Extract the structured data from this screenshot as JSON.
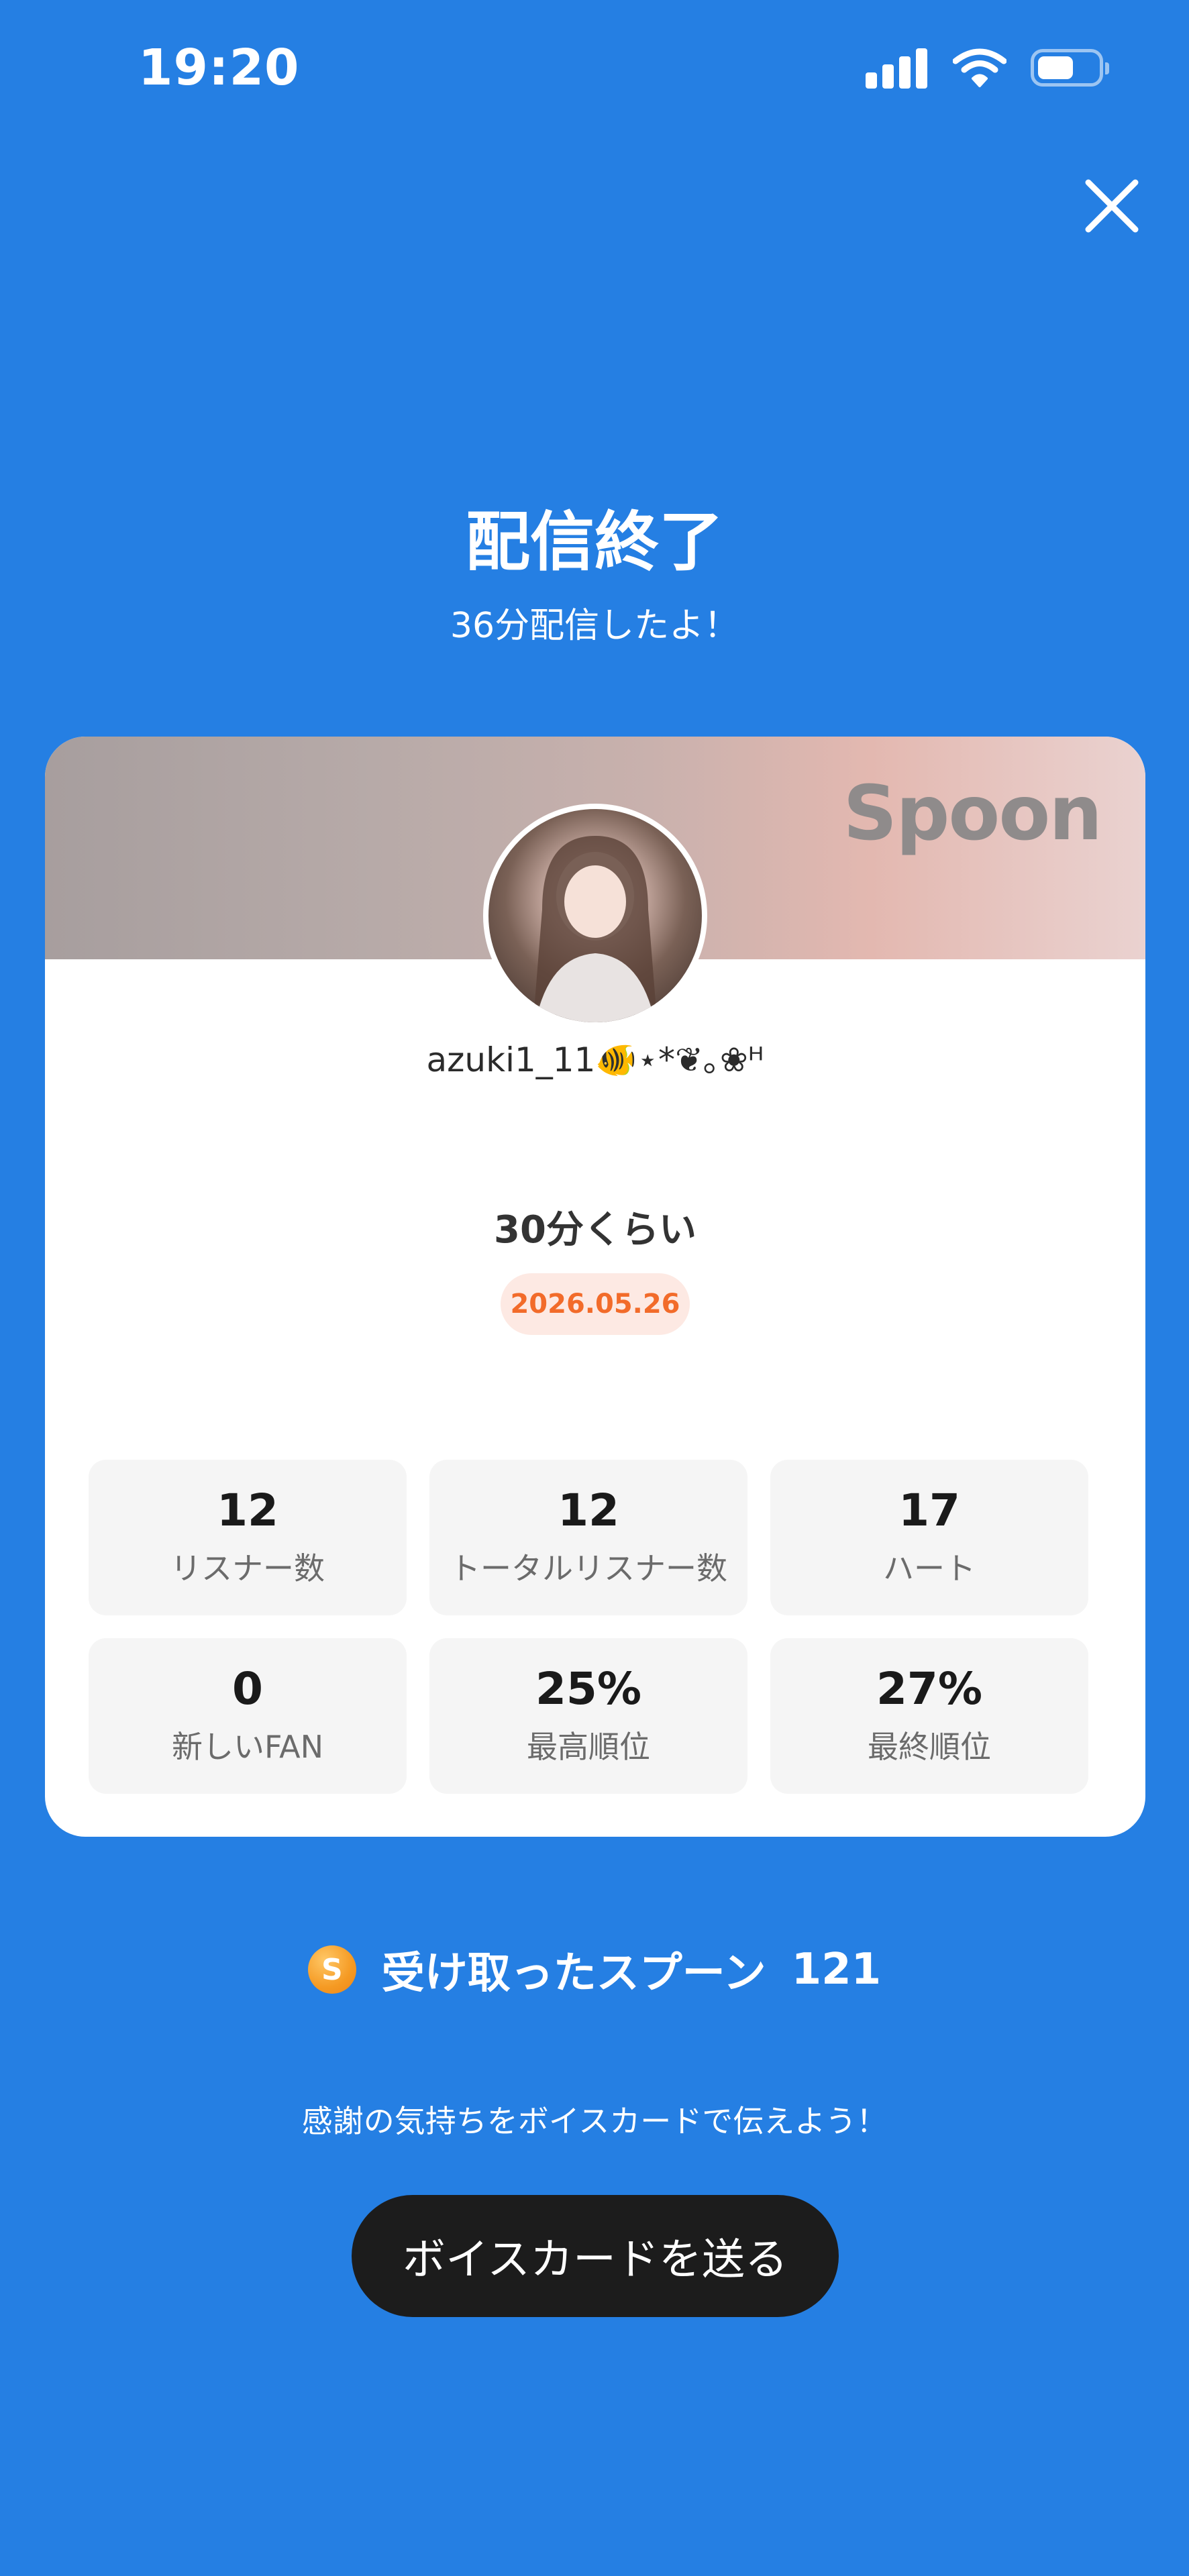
{
  "status_bar": {
    "time": "19:20"
  },
  "header": {
    "title": "配信終了",
    "subtitle": "36分配信したよ！"
  },
  "card": {
    "brand": "Spoon",
    "username": "azuki1_11🐠⋆*❦｡❀ᴴ",
    "broadcast_title": "30分くらい",
    "date": "2026.05.26",
    "stats": [
      {
        "value": "12",
        "label": "リスナー数"
      },
      {
        "value": "12",
        "label": "トータルリスナー数"
      },
      {
        "value": "17",
        "label": "ハート"
      },
      {
        "value": "0",
        "label": "新しいFAN"
      },
      {
        "value": "25%",
        "label": "最高順位"
      },
      {
        "value": "27%",
        "label": "最終順位"
      }
    ]
  },
  "spoons": {
    "icon_letter": "S",
    "label": "受け取ったスプーン",
    "count": "121"
  },
  "footer": {
    "message": "感謝の気持ちをボイスカードで伝えよう！",
    "button_label": "ボイスカードを送る"
  },
  "colors": {
    "background": "#257FE3",
    "badge_text": "#F26B2A",
    "badge_bg": "#FDE9E3",
    "button_bg": "#1C1C1C"
  },
  "icons": [
    "signal-icon",
    "wifi-icon",
    "battery-icon",
    "close-icon",
    "spoon-coin-icon"
  ]
}
